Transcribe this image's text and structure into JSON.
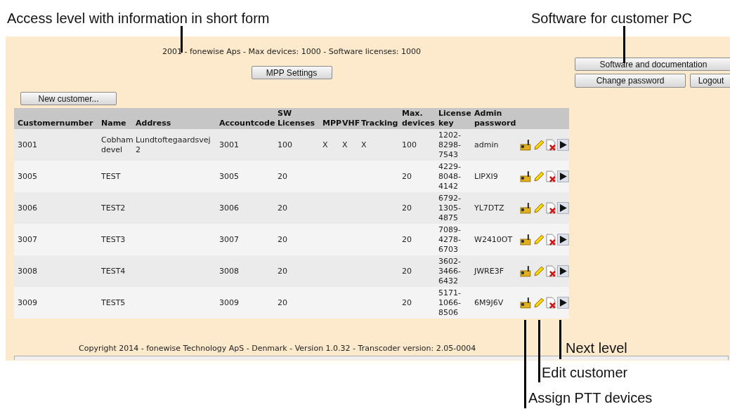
{
  "callouts_top": [
    "Access level with information in short form",
    "Software for customer PC"
  ],
  "info": "2001 - fonewise Aps - Max devices: 1000 - Software licenses: 1000",
  "mpp_button": "MPP Settings",
  "right_buttons": [
    "Software and documentation",
    "Change password",
    "Logout"
  ],
  "new_customer_button": "New customer...",
  "table": {
    "columns": [
      "Customernumber",
      "Name",
      "Address",
      "Accountcode",
      "SW Licenses",
      "MPP",
      "VHF",
      "Tracking",
      "Max. devices",
      "License key",
      "Admin password"
    ],
    "rows": [
      {
        "cells": [
          "3001",
          "Cobham devel",
          "Lundtoftegaardsvej 2",
          "3001",
          "100",
          "X",
          "X",
          "X",
          "100",
          "1202-8298-7543",
          "admin"
        ]
      },
      {
        "cells": [
          "3005",
          "TEST",
          "",
          "3005",
          "20",
          "",
          "",
          "",
          "20",
          "4229-8048-4142",
          "LIPXI9"
        ]
      },
      {
        "cells": [
          "3006",
          "TEST2",
          "",
          "3006",
          "20",
          "",
          "",
          "",
          "20",
          "6792-1305-4875",
          "YL7DTZ"
        ]
      },
      {
        "cells": [
          "3007",
          "TEST3",
          "",
          "3007",
          "20",
          "",
          "",
          "",
          "20",
          "7089-4278-6703",
          "W2410OT"
        ]
      },
      {
        "cells": [
          "3008",
          "TEST4",
          "",
          "3008",
          "20",
          "",
          "",
          "",
          "20",
          "3602-3466-6432",
          "JWRE3F"
        ]
      },
      {
        "cells": [
          "3009",
          "TEST5",
          "",
          "3009",
          "20",
          "",
          "",
          "",
          "20",
          "5171-1066-8506",
          "6M9J6V"
        ]
      }
    ]
  },
  "copyright": "Copyright 2014 - fonewise Technology ApS - Denmark - Version 1.0.32 - Transcoder version: 2.05-0004",
  "callouts_bottom": [
    "Next level",
    "Edit customer",
    "Assign PTT devices"
  ]
}
